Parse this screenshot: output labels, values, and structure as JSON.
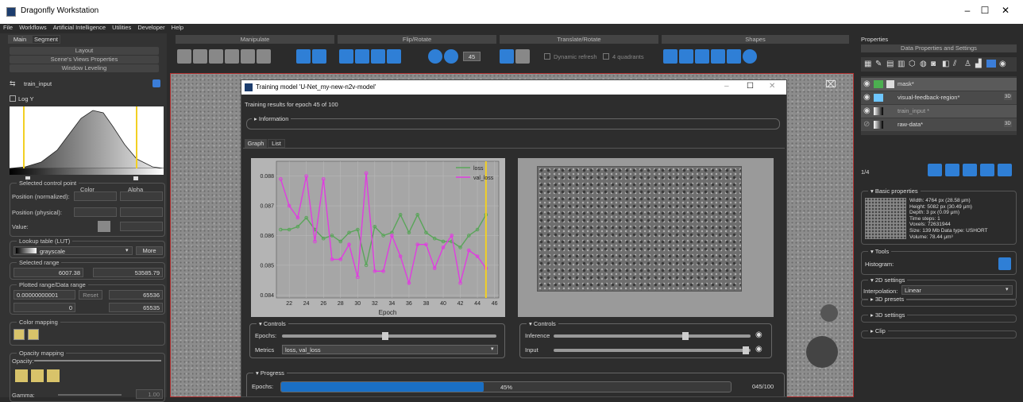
{
  "window": {
    "title": "Dragonfly Workstation",
    "min": "–",
    "max": "☐",
    "close": "✕"
  },
  "menu": [
    "File",
    "Workflows",
    "Artificial Intelligence",
    "Utilities",
    "Developer",
    "Help"
  ],
  "left": {
    "tabs": [
      "Main",
      "Segment"
    ],
    "sections": [
      "Layout",
      "Scene's Views Properties",
      "Window Leveling"
    ],
    "dataset": "train_input",
    "logy": "Log Y",
    "control_point": {
      "title": "Selected control point",
      "color": "Color",
      "alpha": "Alpha",
      "pos_norm": "Position (normalized):",
      "pos_phys": "Position (physical):",
      "value": "Value:"
    },
    "lut": {
      "title": "Lookup table (LUT)",
      "value": "grayscale",
      "more": "More"
    },
    "range": {
      "title": "Selected range",
      "min": "6007.38",
      "max": "53585.79"
    },
    "plotted": {
      "title": "Plotted range/Data range",
      "min": "0.00000000001",
      "reset": "Reset",
      "max": "65536",
      "dmin": "0",
      "dmax": "65535"
    },
    "colormap": {
      "title": "Color mapping"
    },
    "opacity": {
      "title": "Opacity mapping",
      "label": "Opacity:",
      "gamma": "Gamma:",
      "gamma_val": "1.00"
    }
  },
  "toolbar": {
    "groups": [
      "Manipulate",
      "Flip/Rotate",
      "Translate/Rotate",
      "Shapes"
    ],
    "angle": "45",
    "dynamic": "Dynamic refresh",
    "quadrants": "4 quadrants"
  },
  "dialog": {
    "title": "Training model 'U-Net_my-new-n2v-model'",
    "subtitle": "Training results for epoch 45 of 100",
    "information": "Information",
    "tabs": [
      "Graph",
      "List"
    ],
    "controls_left": {
      "title": "Controls",
      "epochs": "Epochs:",
      "metrics": "Metrics",
      "metrics_val": "loss, val_loss"
    },
    "controls_right": {
      "title": "Controls",
      "inference": "Inference",
      "input": "Input"
    },
    "progress": {
      "title": "Progress",
      "epochs": "Epochs:",
      "percent": "45%",
      "count": "045/100",
      "fraction": 0.45
    }
  },
  "chart_data": {
    "type": "line",
    "xlabel": "Epoch",
    "ylabel": "",
    "xlim": [
      20.5,
      46.5
    ],
    "ylim": [
      0.0839,
      0.0885
    ],
    "xticks": [
      22,
      24,
      26,
      28,
      30,
      32,
      34,
      36,
      38,
      40,
      42,
      44,
      46
    ],
    "yticks": [
      0.084,
      0.085,
      0.086,
      0.087,
      0.088
    ],
    "x": [
      21,
      22,
      23,
      24,
      25,
      26,
      27,
      28,
      29,
      30,
      31,
      32,
      33,
      34,
      35,
      36,
      37,
      38,
      39,
      40,
      41,
      42,
      43,
      44,
      45
    ],
    "series": [
      {
        "name": "loss",
        "color": "#5aa55a",
        "values": [
          0.0862,
          0.0862,
          0.0863,
          0.0866,
          0.0862,
          0.0859,
          0.086,
          0.0858,
          0.0861,
          0.0862,
          0.085,
          0.0863,
          0.086,
          0.0861,
          0.0867,
          0.0861,
          0.0867,
          0.0861,
          0.0859,
          0.0858,
          0.0858,
          0.0856,
          0.086,
          0.0862,
          0.0867
        ]
      },
      {
        "name": "val_loss",
        "color": "#e03ce0",
        "values": [
          0.0879,
          0.087,
          0.0866,
          0.088,
          0.0858,
          0.0879,
          0.0852,
          0.0852,
          0.0857,
          0.0846,
          0.0881,
          0.0848,
          0.0848,
          0.086,
          0.0853,
          0.0844,
          0.0857,
          0.0857,
          0.0849,
          0.0856,
          0.086,
          0.0844,
          0.0855,
          0.0853,
          0.0849
        ]
      }
    ],
    "marker_x": 45,
    "legend": "top-right"
  },
  "right": {
    "title": "Properties",
    "section": "Data Properties and Settings",
    "layers": [
      {
        "name": "mask*",
        "badge": ""
      },
      {
        "name": "visual-feedback-region*",
        "badge": "3D"
      },
      {
        "name": "train_input *",
        "badge": ""
      },
      {
        "name": "raw-data*",
        "badge": "3D"
      }
    ],
    "count": "1/4",
    "basic": {
      "title": "Basic properties",
      "lines": [
        "Width: 4764 px (28.58 μm)",
        "Height: 5082 px (30.49 μm)",
        "Depth: 3 px (0.09 μm)",
        "Time steps: 1",
        "Voxels: 72631944",
        "Size: 139 Mb  Data type: USHORT",
        "Volume: 78.44 μm³"
      ]
    },
    "tools": {
      "title": "Tools",
      "histogram": "Histogram:"
    },
    "settings2d": {
      "title": "2D settings",
      "interp": "Interpolation:",
      "interp_val": "Linear"
    },
    "presets": "3D presets",
    "settings3d": "3D settings",
    "clip": "Clip"
  }
}
